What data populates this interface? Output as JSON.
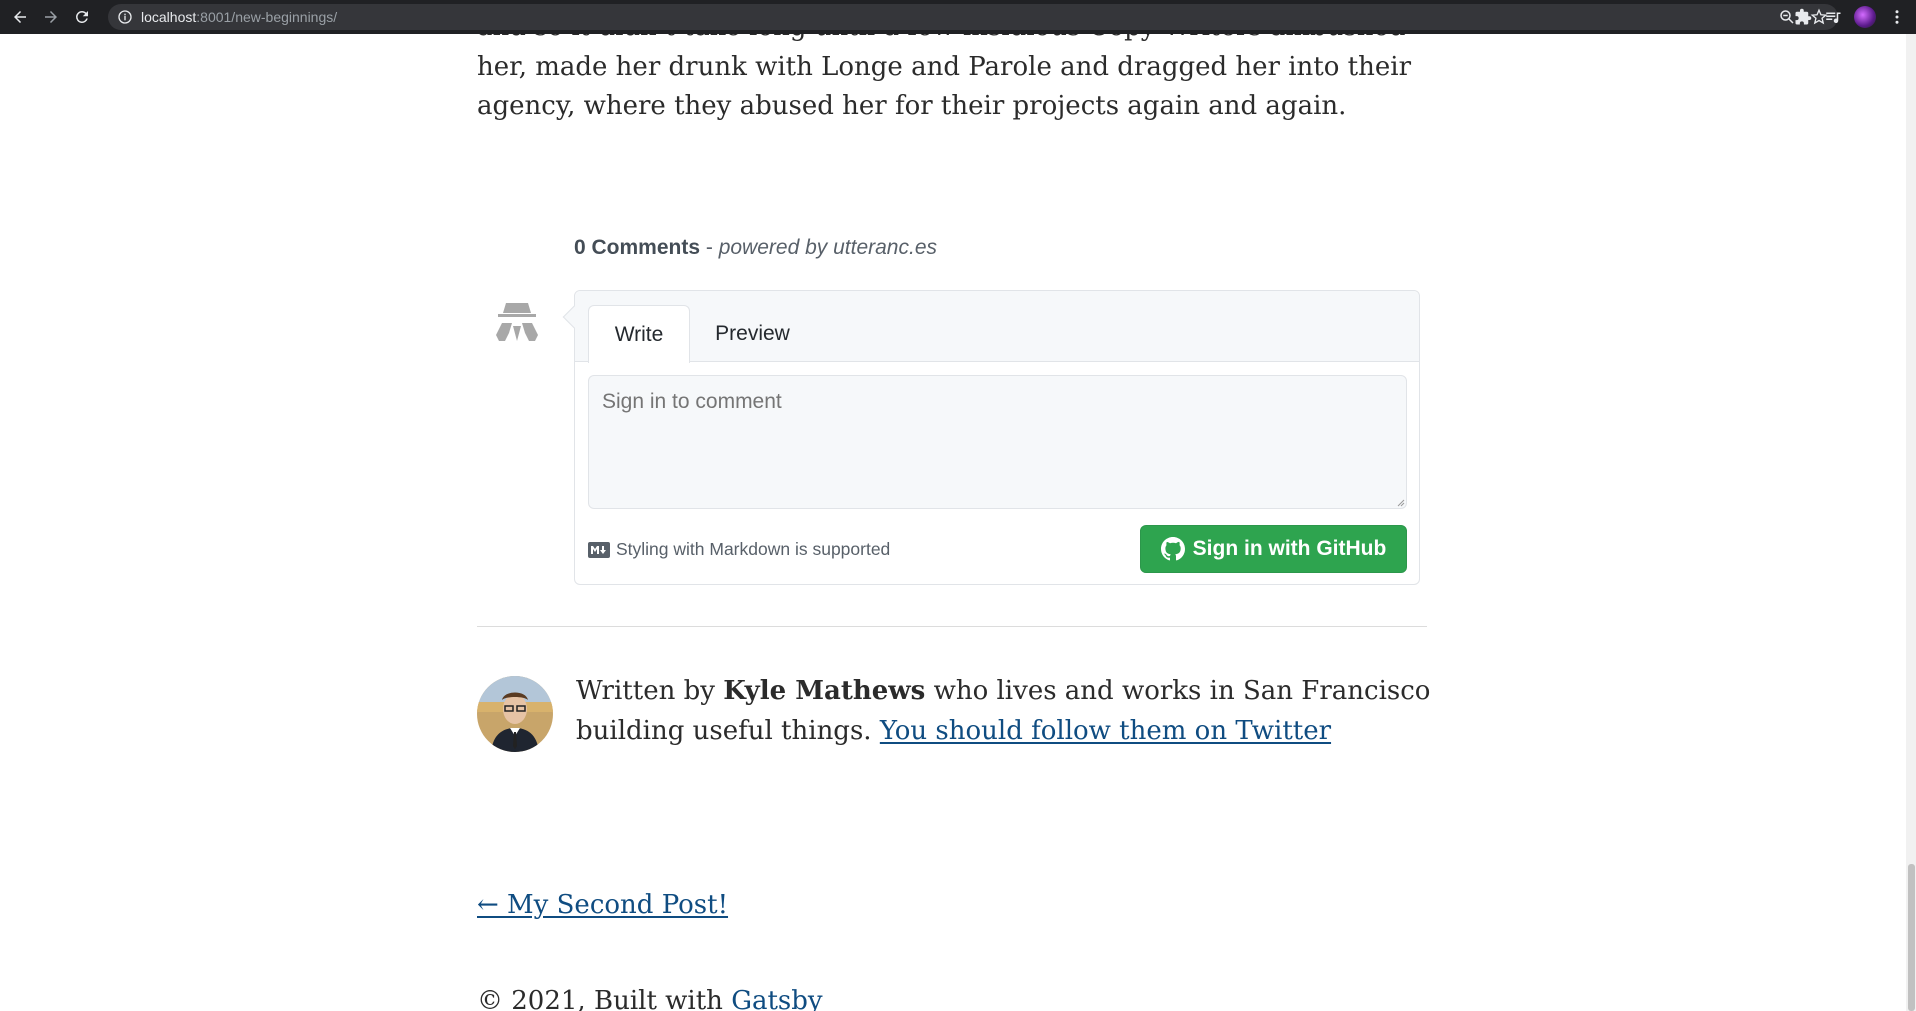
{
  "browser": {
    "url_host": "localhost",
    "url_rest": ":8001/new-beginnings/"
  },
  "article": {
    "paragraph_tail": "and so it didn’t take long until a few insidious Copy Writers ambushed her, made her drunk with Longe and Parole and dragged her into their agency, where they abused her for their projects again and again."
  },
  "comments": {
    "count": "0 Comments",
    "separator": " - ",
    "powered": "powered by utteranc.es",
    "tabs": [
      "Write",
      "Preview"
    ],
    "placeholder": "Sign in to comment",
    "markdown_note": "Styling with Markdown is supported",
    "signin_label": "Sign in with GitHub"
  },
  "bio": {
    "prefix": "Written by ",
    "name": "Kyle Mathews",
    "suffix": " who lives and works in San Francisco building useful things. ",
    "twitter_link": "You should follow them on Twitter"
  },
  "nav": {
    "prev_post": "← My Second Post!"
  },
  "footer": {
    "copyright": "© 2021, Built with ",
    "gatsby_link": "Gatsby"
  },
  "colors": {
    "link": "#0f4c81",
    "github_green": "#2ea44f",
    "chrome_bg": "#202124"
  },
  "scroll_position_fraction": 0.92
}
